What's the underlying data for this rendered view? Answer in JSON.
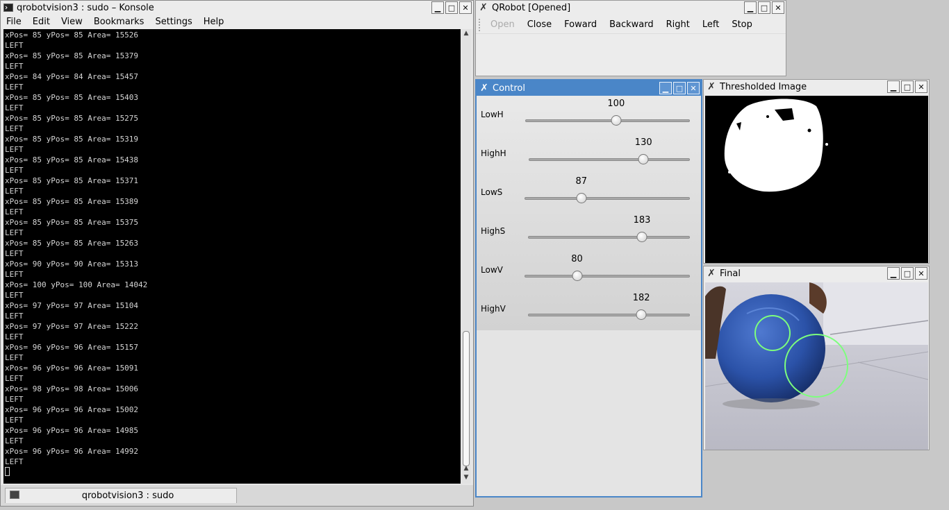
{
  "konsole": {
    "title": "qrobotvision3 : sudo – Konsole",
    "menu": [
      "File",
      "Edit",
      "View",
      "Bookmarks",
      "Settings",
      "Help"
    ],
    "lines": [
      "xPos= 85 yPos= 85 Area= 15526",
      "LEFT",
      "xPos= 85 yPos= 85 Area= 15379",
      "LEFT",
      "xPos= 84 yPos= 84 Area= 15457",
      "LEFT",
      "xPos= 85 yPos= 85 Area= 15403",
      "LEFT",
      "xPos= 85 yPos= 85 Area= 15275",
      "LEFT",
      "xPos= 85 yPos= 85 Area= 15319",
      "LEFT",
      "xPos= 85 yPos= 85 Area= 15438",
      "LEFT",
      "xPos= 85 yPos= 85 Area= 15371",
      "LEFT",
      "xPos= 85 yPos= 85 Area= 15389",
      "LEFT",
      "xPos= 85 yPos= 85 Area= 15375",
      "LEFT",
      "xPos= 85 yPos= 85 Area= 15263",
      "LEFT",
      "xPos= 90 yPos= 90 Area= 15313",
      "LEFT",
      "xPos= 100 yPos= 100 Area= 14042",
      "LEFT",
      "xPos= 97 yPos= 97 Area= 15104",
      "LEFT",
      "xPos= 97 yPos= 97 Area= 15222",
      "LEFT",
      "xPos= 96 yPos= 96 Area= 15157",
      "LEFT",
      "xPos= 96 yPos= 96 Area= 15091",
      "LEFT",
      "xPos= 98 yPos= 98 Area= 15006",
      "LEFT",
      "xPos= 96 yPos= 96 Area= 15002",
      "LEFT",
      "xPos= 96 yPos= 96 Area= 14985",
      "LEFT",
      "xPos= 96 yPos= 96 Area= 14992",
      "LEFT"
    ],
    "session_tab": "qrobotvision3 : sudo"
  },
  "qrobot": {
    "title": "QRobot [Opened]",
    "toolbar": [
      "Open",
      "Close",
      "Foward",
      "Backward",
      "Right",
      "Left",
      "Stop"
    ]
  },
  "control": {
    "title": "Control",
    "sliders": [
      {
        "label": "LowH",
        "value": 100,
        "max": 179
      },
      {
        "label": "HighH",
        "value": 130,
        "max": 179
      },
      {
        "label": "LowS",
        "value": 87,
        "max": 255
      },
      {
        "label": "HighS",
        "value": 183,
        "max": 255
      },
      {
        "label": "LowV",
        "value": 80,
        "max": 255
      },
      {
        "label": "HighV",
        "value": 182,
        "max": 255
      }
    ]
  },
  "thresholded": {
    "title": "Thresholded Image"
  },
  "final": {
    "title": "Final"
  },
  "colors": {
    "active_title": "#4a86c8",
    "circle": "#7dff7d",
    "ball": "#2b52a8"
  }
}
